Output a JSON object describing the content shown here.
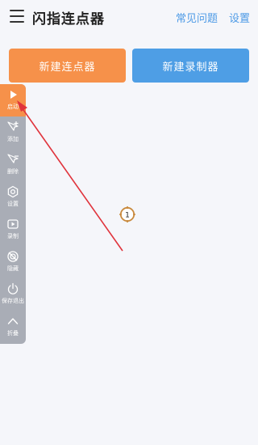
{
  "header": {
    "title": "闪指连点器",
    "faq_label": "常见问题",
    "settings_label": "设置"
  },
  "actions": {
    "new_clicker_label": "新建连点器",
    "new_recorder_label": "新建录制器"
  },
  "toolbar": {
    "items": [
      {
        "label": "启动",
        "icon": "play-icon"
      },
      {
        "label": "添加",
        "icon": "add-pointer-icon"
      },
      {
        "label": "删除",
        "icon": "remove-pointer-icon"
      },
      {
        "label": "设置",
        "icon": "gear-icon"
      },
      {
        "label": "录制",
        "icon": "record-icon"
      },
      {
        "label": "隐藏",
        "icon": "hide-icon"
      },
      {
        "label": "保存退出",
        "icon": "power-icon"
      },
      {
        "label": "折叠",
        "icon": "chevron-up-icon"
      }
    ]
  },
  "canvas": {
    "marker_number": "1"
  },
  "colors": {
    "accent_orange": "#f6914a",
    "accent_blue": "#4e9ee5",
    "toolbar_gray": "#a9adb6",
    "annotation_red": "#e0343c"
  }
}
